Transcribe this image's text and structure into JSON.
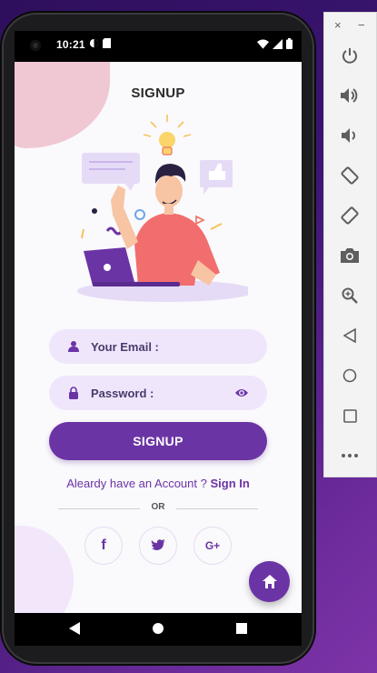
{
  "status_bar": {
    "time": "10:21"
  },
  "app": {
    "title": "SIGNUP",
    "email_placeholder": "Your Email :",
    "password_placeholder": "Password :",
    "signup_button": "SIGNUP",
    "account_prompt": "Aleardy have an Account ? ",
    "sign_in_link": "Sign In",
    "or_text": "OR",
    "social": {
      "facebook": "f",
      "google": "G+"
    }
  },
  "colors": {
    "primary": "#6b34a5",
    "field_bg": "#efe6fc",
    "pink_blob": "#f0c8d4"
  },
  "emulator_panel": {
    "close_glyph": "×",
    "minimize_glyph": "−",
    "controls": [
      "power-icon",
      "volume-up-icon",
      "volume-down-icon",
      "rotate-left-icon",
      "rotate-right-icon",
      "camera-icon",
      "zoom-icon",
      "back-icon",
      "home-icon",
      "overview-icon",
      "more-icon"
    ]
  }
}
